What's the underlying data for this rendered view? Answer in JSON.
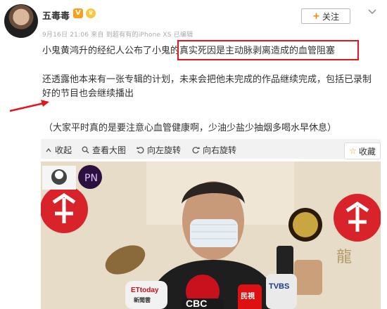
{
  "post": {
    "author": "五毒毒",
    "meta": "9月16日 21:06 来自 到超有有的iPhone XS  已编辑",
    "follow_label": "关注",
    "paragraphs": [
      "小鬼黄鸿升的经纪人公布了小鬼的真实死因是主动脉剥离造成的血管阻塞",
      "还透露他本来有一张专辑的计划，未来会把他未完成的作品继续完成，包括已录制好的节目也会继续播出",
      "（大家平时真的是要注意心血管健康啊，少油少盐少抽烟多喝水早休息）"
    ]
  },
  "media_toolbar": {
    "collapse": "收起",
    "view_large": "查看大图",
    "rotate_left": "向左旋转",
    "rotate_right": "向右旋转",
    "collect": "收藏"
  },
  "photo": {
    "watermark": "龍",
    "mic_labels": [
      "ETtoday",
      "新聞雲",
      "民視",
      "TVBS",
      "CBC"
    ]
  },
  "colors": {
    "highlight_box": "#e8141c",
    "arrow": "#e8141c",
    "accent": "#ff8200"
  },
  "icons": [
    "more-chevron-icon",
    "collapse-icon",
    "magnifier-icon",
    "rotate-left-icon",
    "rotate-right-icon",
    "star-icon",
    "plus-icon"
  ]
}
